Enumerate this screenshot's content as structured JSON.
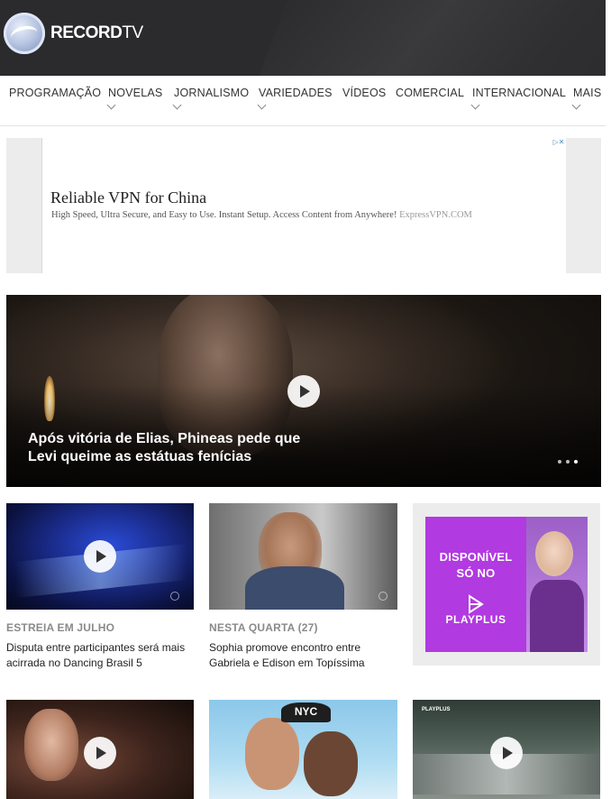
{
  "header": {
    "logo_text_bold": "RECORD",
    "logo_text_light": "TV"
  },
  "nav": {
    "items": [
      {
        "label": "PROGRAMAÇÃO",
        "has_dropdown": false
      },
      {
        "label": "NOVELAS",
        "has_dropdown": true
      },
      {
        "label": "JORNALISMO",
        "has_dropdown": true
      },
      {
        "label": "VARIEDADES",
        "has_dropdown": true
      },
      {
        "label": "VÍDEOS",
        "has_dropdown": false
      },
      {
        "label": "COMERCIAL",
        "has_dropdown": false
      },
      {
        "label": "INTERNACIONAL",
        "has_dropdown": true
      },
      {
        "label": "MAIS",
        "has_dropdown": true
      }
    ]
  },
  "ad": {
    "title": "Reliable VPN for China",
    "description": "High Speed, Ultra Secure, and Easy to Use. Instant Setup. Access Content from Anywhere!",
    "domain": "ExpressVPN.COM"
  },
  "hero": {
    "title": "Após vitória de Elias, Phineas pede que Levi queime as estátuas fenícias",
    "slides": 3,
    "active_slide": 3
  },
  "cards": [
    {
      "label": "ESTREIA EM JULHO",
      "text": "Disputa entre participantes será mais acirrada no Dancing Brasil 5"
    },
    {
      "label": "NESTA QUARTA (27)",
      "text": "Sophia promove encontro entre Gabriela e Edison em Topíssima"
    }
  ],
  "promo": {
    "line1": "DISPONÍVEL",
    "line2": "SÓ NO",
    "brand": "PLAYPLUS"
  },
  "bottom_cards": {
    "cap_text": "NYC",
    "mini_logo_text": "PLAYPLUS"
  },
  "colors": {
    "header_bg": "#2b2b2d",
    "promo_purple": "#b13ae0",
    "label_gray": "#8a8a8a"
  }
}
